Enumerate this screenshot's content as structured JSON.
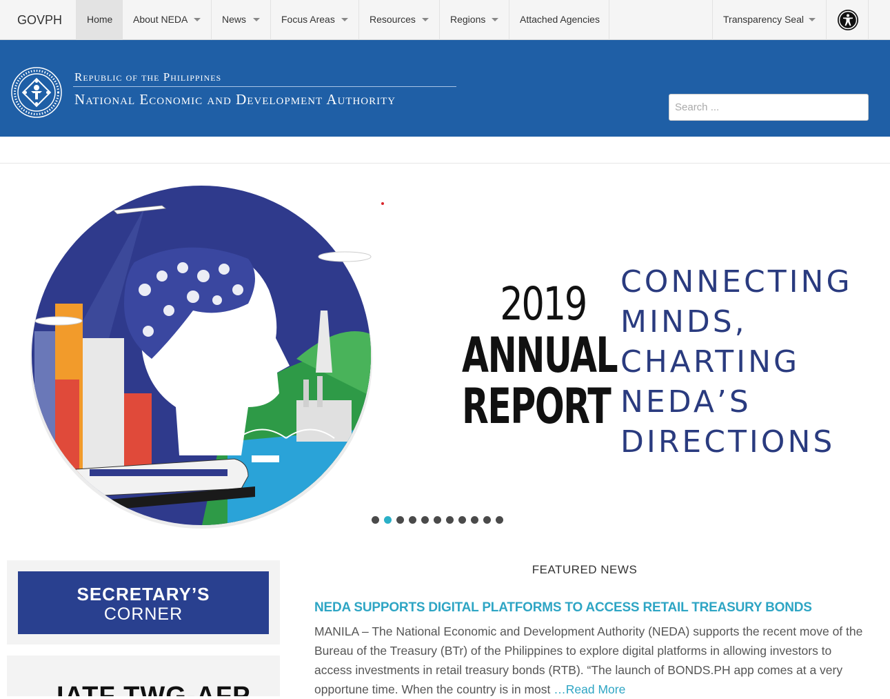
{
  "nav": {
    "brand": "GOVPH",
    "items": [
      {
        "label": "Home"
      },
      {
        "label": "About NEDA"
      },
      {
        "label": "News"
      },
      {
        "label": "Focus Areas"
      },
      {
        "label": "Resources"
      },
      {
        "label": "Regions"
      },
      {
        "label": "Attached Agencies"
      }
    ],
    "right_item": "Transparency Seal",
    "accessibility_icon": "accessibility-icon"
  },
  "header": {
    "republic": "Republic of the Philippines",
    "authority": "National Economic and Development Authority",
    "search_placeholder": "Search ..."
  },
  "colors": {
    "header_blue": "#1f5fa6",
    "accent_teal": "#2ea5c4",
    "secretary_blue": "#29408f",
    "tagline_navy": "#2a3b7f"
  },
  "slider": {
    "year": "2019",
    "title_line1": "ANNUAL",
    "title_line2": "REPORT",
    "tagline": [
      "CONNECTING",
      "MINDS,",
      "CHARTING",
      "NEDA’S",
      "DIRECTIONS"
    ],
    "slide_count": 11,
    "active_slide": 2
  },
  "sidebar": {
    "secretary_line1": "SECRETARY’S",
    "secretary_line2": "CORNER",
    "iate": "IATF TWG-AFP"
  },
  "featured": {
    "section_title": "FEATURED NEWS",
    "headline": "NEDA SUPPORTS DIGITAL PLATFORMS TO ACCESS RETAIL TREASURY BONDS",
    "excerpt": "MANILA – The National Economic and Development Authority (NEDA) supports the recent move of the Bureau of the Treasury (BTr) of the Philippines to explore digital platforms in allowing investors to access investments in retail treasury bonds (RTB). “The launch of BONDS.PH app comes at a very opportune time. When the country is in most ",
    "read_more": "…Read More"
  }
}
